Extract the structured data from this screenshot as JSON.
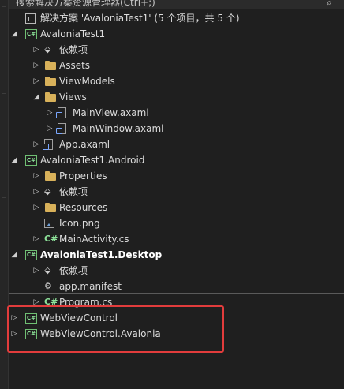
{
  "search": {
    "placeholder": "搜索解决方案资源管理器(Ctrl+;)"
  },
  "tree": [
    {
      "label": "解决方案 'AvaloniaTest1' (5 个项目，共 5 个)",
      "icon": "solution-icon",
      "indent": 0,
      "arrow": "none",
      "bold": false
    },
    {
      "label": "AvaloniaTest1",
      "icon": "csproj-icon",
      "indent": 0,
      "arrow": "expanded",
      "bold": false
    },
    {
      "label": "依赖项",
      "icon": "dependencies-icon",
      "indent": 1,
      "arrow": "collapsed",
      "bold": false
    },
    {
      "label": "Assets",
      "icon": "folder-icon",
      "indent": 1,
      "arrow": "collapsed",
      "bold": false
    },
    {
      "label": "ViewModels",
      "icon": "folder-icon",
      "indent": 1,
      "arrow": "collapsed",
      "bold": false
    },
    {
      "label": "Views",
      "icon": "folder-icon",
      "indent": 1,
      "arrow": "expanded",
      "bold": false
    },
    {
      "label": "MainView.axaml",
      "icon": "axaml-icon",
      "indent": 2,
      "arrow": "collapsed",
      "bold": false
    },
    {
      "label": "MainWindow.axaml",
      "icon": "axaml-icon",
      "indent": 2,
      "arrow": "collapsed",
      "bold": false
    },
    {
      "label": "App.axaml",
      "icon": "axaml-icon",
      "indent": 1,
      "arrow": "collapsed",
      "bold": false
    },
    {
      "label": "AvaloniaTest1.Android",
      "icon": "csproj-icon",
      "indent": 0,
      "arrow": "expanded",
      "bold": false
    },
    {
      "label": "Properties",
      "icon": "properties-icon",
      "indent": 1,
      "arrow": "collapsed",
      "bold": false
    },
    {
      "label": "依赖项",
      "icon": "dependencies-icon",
      "indent": 1,
      "arrow": "collapsed",
      "bold": false
    },
    {
      "label": "Resources",
      "icon": "folder-icon",
      "indent": 1,
      "arrow": "collapsed",
      "bold": false
    },
    {
      "label": "Icon.png",
      "icon": "image-file-icon",
      "indent": 1,
      "arrow": "none",
      "bold": false
    },
    {
      "label": "MainActivity.cs",
      "icon": "csharp-file-icon",
      "indent": 1,
      "arrow": "collapsed",
      "bold": false
    },
    {
      "label": "AvaloniaTest1.Desktop",
      "icon": "csproj-icon",
      "indent": 0,
      "arrow": "expanded",
      "bold": true
    },
    {
      "label": "依赖项",
      "icon": "dependencies-icon",
      "indent": 1,
      "arrow": "collapsed",
      "bold": false
    },
    {
      "label": "app.manifest",
      "icon": "manifest-icon",
      "indent": 1,
      "arrow": "none",
      "bold": false
    },
    {
      "label": "Program.cs",
      "icon": "csharp-file-icon",
      "indent": 1,
      "arrow": "collapsed",
      "bold": false
    },
    {
      "label": "WebViewControl",
      "icon": "csproj-icon",
      "indent": 0,
      "arrow": "collapsed",
      "bold": false
    },
    {
      "label": "WebViewControl.Avalonia",
      "icon": "csproj-icon",
      "indent": 0,
      "arrow": "collapsed",
      "bold": false
    }
  ],
  "colors": {
    "highlight_border": "#e23c3c",
    "background": "#1f1f1f",
    "csproj_green": "#8ee39a",
    "folder": "#d8b15a"
  }
}
